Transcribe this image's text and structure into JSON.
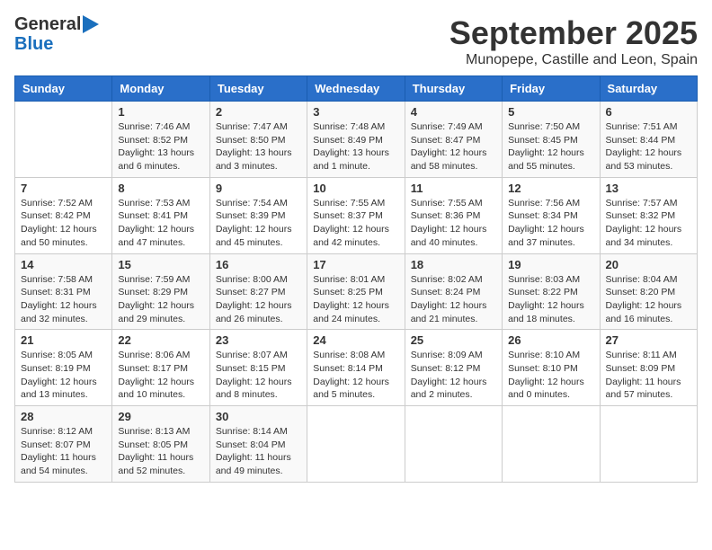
{
  "logo": {
    "general": "General",
    "blue": "Blue",
    "arrow": "▶"
  },
  "title": "September 2025",
  "subtitle": "Munopepe, Castille and Leon, Spain",
  "headers": [
    "Sunday",
    "Monday",
    "Tuesday",
    "Wednesday",
    "Thursday",
    "Friday",
    "Saturday"
  ],
  "weeks": [
    [
      {
        "day": "",
        "info": ""
      },
      {
        "day": "1",
        "info": "Sunrise: 7:46 AM\nSunset: 8:52 PM\nDaylight: 13 hours\nand 6 minutes."
      },
      {
        "day": "2",
        "info": "Sunrise: 7:47 AM\nSunset: 8:50 PM\nDaylight: 13 hours\nand 3 minutes."
      },
      {
        "day": "3",
        "info": "Sunrise: 7:48 AM\nSunset: 8:49 PM\nDaylight: 13 hours\nand 1 minute."
      },
      {
        "day": "4",
        "info": "Sunrise: 7:49 AM\nSunset: 8:47 PM\nDaylight: 12 hours\nand 58 minutes."
      },
      {
        "day": "5",
        "info": "Sunrise: 7:50 AM\nSunset: 8:45 PM\nDaylight: 12 hours\nand 55 minutes."
      },
      {
        "day": "6",
        "info": "Sunrise: 7:51 AM\nSunset: 8:44 PM\nDaylight: 12 hours\nand 53 minutes."
      }
    ],
    [
      {
        "day": "7",
        "info": "Sunrise: 7:52 AM\nSunset: 8:42 PM\nDaylight: 12 hours\nand 50 minutes."
      },
      {
        "day": "8",
        "info": "Sunrise: 7:53 AM\nSunset: 8:41 PM\nDaylight: 12 hours\nand 47 minutes."
      },
      {
        "day": "9",
        "info": "Sunrise: 7:54 AM\nSunset: 8:39 PM\nDaylight: 12 hours\nand 45 minutes."
      },
      {
        "day": "10",
        "info": "Sunrise: 7:55 AM\nSunset: 8:37 PM\nDaylight: 12 hours\nand 42 minutes."
      },
      {
        "day": "11",
        "info": "Sunrise: 7:55 AM\nSunset: 8:36 PM\nDaylight: 12 hours\nand 40 minutes."
      },
      {
        "day": "12",
        "info": "Sunrise: 7:56 AM\nSunset: 8:34 PM\nDaylight: 12 hours\nand 37 minutes."
      },
      {
        "day": "13",
        "info": "Sunrise: 7:57 AM\nSunset: 8:32 PM\nDaylight: 12 hours\nand 34 minutes."
      }
    ],
    [
      {
        "day": "14",
        "info": "Sunrise: 7:58 AM\nSunset: 8:31 PM\nDaylight: 12 hours\nand 32 minutes."
      },
      {
        "day": "15",
        "info": "Sunrise: 7:59 AM\nSunset: 8:29 PM\nDaylight: 12 hours\nand 29 minutes."
      },
      {
        "day": "16",
        "info": "Sunrise: 8:00 AM\nSunset: 8:27 PM\nDaylight: 12 hours\nand 26 minutes."
      },
      {
        "day": "17",
        "info": "Sunrise: 8:01 AM\nSunset: 8:25 PM\nDaylight: 12 hours\nand 24 minutes."
      },
      {
        "day": "18",
        "info": "Sunrise: 8:02 AM\nSunset: 8:24 PM\nDaylight: 12 hours\nand 21 minutes."
      },
      {
        "day": "19",
        "info": "Sunrise: 8:03 AM\nSunset: 8:22 PM\nDaylight: 12 hours\nand 18 minutes."
      },
      {
        "day": "20",
        "info": "Sunrise: 8:04 AM\nSunset: 8:20 PM\nDaylight: 12 hours\nand 16 minutes."
      }
    ],
    [
      {
        "day": "21",
        "info": "Sunrise: 8:05 AM\nSunset: 8:19 PM\nDaylight: 12 hours\nand 13 minutes."
      },
      {
        "day": "22",
        "info": "Sunrise: 8:06 AM\nSunset: 8:17 PM\nDaylight: 12 hours\nand 10 minutes."
      },
      {
        "day": "23",
        "info": "Sunrise: 8:07 AM\nSunset: 8:15 PM\nDaylight: 12 hours\nand 8 minutes."
      },
      {
        "day": "24",
        "info": "Sunrise: 8:08 AM\nSunset: 8:14 PM\nDaylight: 12 hours\nand 5 minutes."
      },
      {
        "day": "25",
        "info": "Sunrise: 8:09 AM\nSunset: 8:12 PM\nDaylight: 12 hours\nand 2 minutes."
      },
      {
        "day": "26",
        "info": "Sunrise: 8:10 AM\nSunset: 8:10 PM\nDaylight: 12 hours\nand 0 minutes."
      },
      {
        "day": "27",
        "info": "Sunrise: 8:11 AM\nSunset: 8:09 PM\nDaylight: 11 hours\nand 57 minutes."
      }
    ],
    [
      {
        "day": "28",
        "info": "Sunrise: 8:12 AM\nSunset: 8:07 PM\nDaylight: 11 hours\nand 54 minutes."
      },
      {
        "day": "29",
        "info": "Sunrise: 8:13 AM\nSunset: 8:05 PM\nDaylight: 11 hours\nand 52 minutes."
      },
      {
        "day": "30",
        "info": "Sunrise: 8:14 AM\nSunset: 8:04 PM\nDaylight: 11 hours\nand 49 minutes."
      },
      {
        "day": "",
        "info": ""
      },
      {
        "day": "",
        "info": ""
      },
      {
        "day": "",
        "info": ""
      },
      {
        "day": "",
        "info": ""
      }
    ]
  ]
}
